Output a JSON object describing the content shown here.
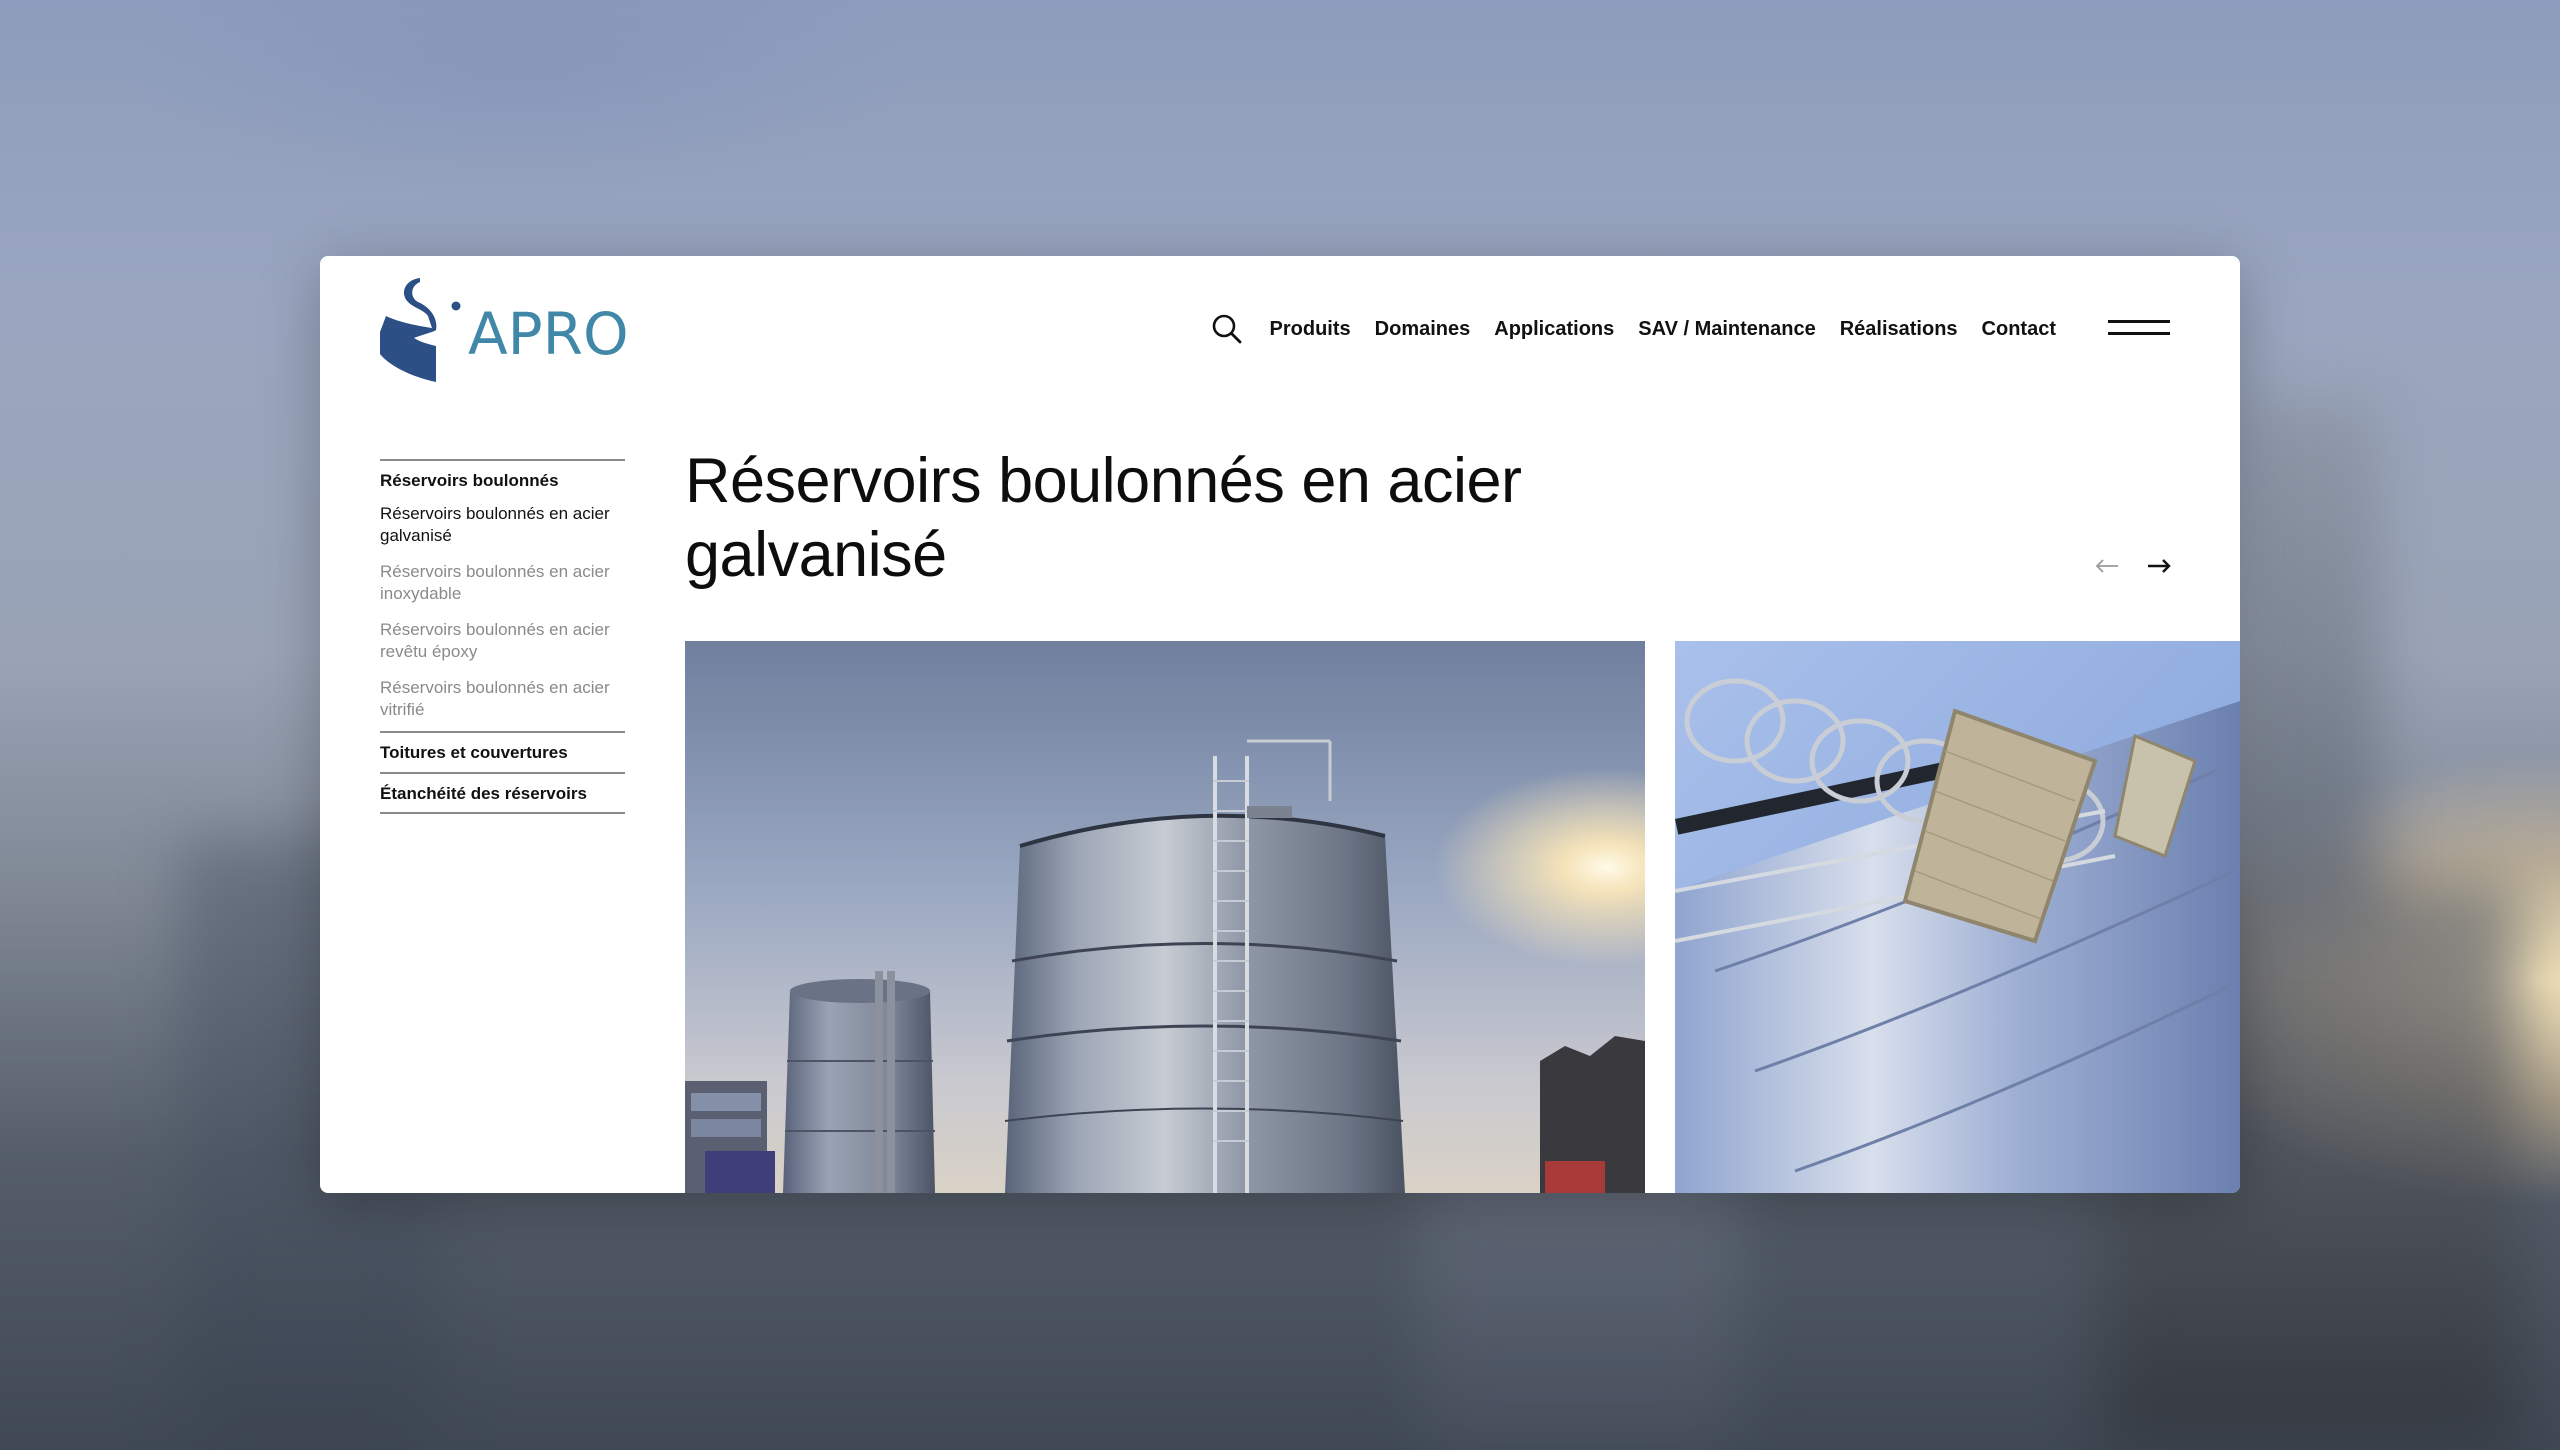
{
  "colors": {
    "brand_blue": "#4187a8",
    "brand_navy": "#2c4f86",
    "text": "#111111",
    "muted_text": "#8a8a8a",
    "divider": "#8a8a8a"
  },
  "header": {
    "logo_text": "APRO",
    "search_icon": "search-icon",
    "nav": [
      "Produits",
      "Domaines",
      "Applications",
      "SAV / Maintenance",
      "Réalisations",
      "Contact"
    ],
    "menu_icon": "hamburger-icon"
  },
  "sidebar": {
    "groups": [
      {
        "label": "Réservoirs boulonnés",
        "items": [
          {
            "label": "Réservoirs boulonnés en acier galvanisé",
            "state": "active"
          },
          {
            "label": "Réservoirs boulonnés en acier inoxydable",
            "state": "muted"
          },
          {
            "label": "Réservoirs boulonnés en acier revêtu époxy",
            "state": "muted"
          },
          {
            "label": "Réservoirs boulonnés en acier vitrifié",
            "state": "muted"
          }
        ]
      },
      {
        "label": "Toitures et couvertures",
        "items": []
      },
      {
        "label": "Étanchéité des réservoirs",
        "items": []
      }
    ]
  },
  "main": {
    "title": "Réservoirs boulonnés en acier galvanisé",
    "carousel": {
      "prev_icon": "arrow-left-icon",
      "next_icon": "arrow-right-icon",
      "slides": [
        {
          "icon": "galvanized-tanks-photo"
        },
        {
          "icon": "tank-ladder-closeup-photo"
        }
      ]
    }
  }
}
